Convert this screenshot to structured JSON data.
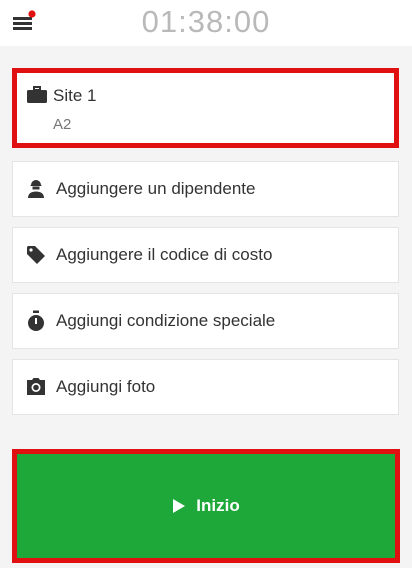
{
  "header": {
    "timer": "01:38:00",
    "menu_icon": "menu-notification-icon"
  },
  "site": {
    "title": "Site 1",
    "subtitle": "A2",
    "icon": "briefcase-icon"
  },
  "actions": [
    {
      "label": "Aggiungere un dipendente",
      "icon": "worker-icon"
    },
    {
      "label": "Aggiungere il codice di costo",
      "icon": "tag-icon"
    },
    {
      "label": "Aggiungi condizione speciale",
      "icon": "stopwatch-icon"
    },
    {
      "label": "Aggiungi foto",
      "icon": "camera-icon"
    }
  ],
  "start": {
    "label": "Inizio",
    "icon": "play-icon"
  },
  "colors": {
    "highlight_border": "#e01010",
    "start_button": "#1ea83a",
    "notification_dot": "#e01010"
  }
}
